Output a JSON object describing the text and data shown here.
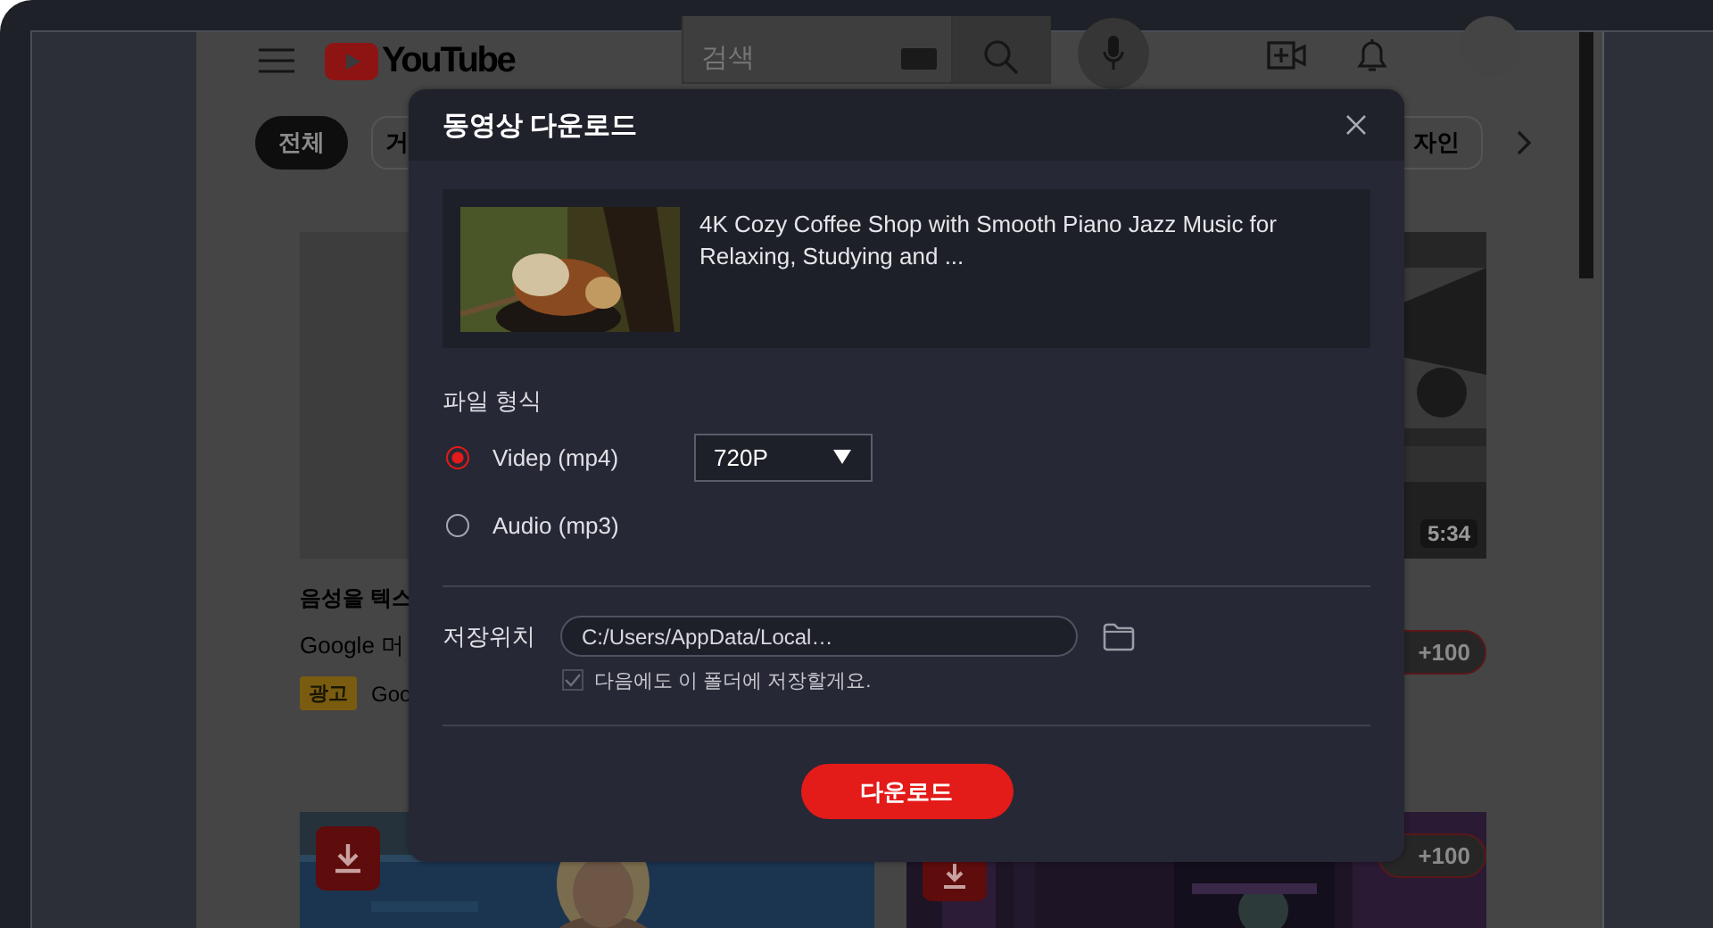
{
  "background": {
    "logo": "YouTube",
    "search": {
      "placeholder": "검색"
    },
    "chips": [
      {
        "label": "전체",
        "selected": true
      },
      {
        "label": "거",
        "selected": false
      },
      {
        "label": "자인",
        "selected": false
      }
    ],
    "cards": [
      {
        "title": "음성을 텍스",
        "channel": "Google 머",
        "ad_badge": "광고",
        "advertiser": "Goo"
      },
      {
        "duration": "5:34",
        "points": "+100"
      }
    ],
    "bottom_cards": [
      {
        "kind": "download"
      },
      {
        "kind": "points",
        "points": "+100"
      }
    ]
  },
  "dialog": {
    "title": "동영상 다운로드",
    "video": {
      "title": "4K Cozy Coffee Shop with Smooth Piano Jazz Music for Relaxing, Studying and ..."
    },
    "format_label": "파일 형식",
    "formats": [
      {
        "label": "Videp (mp4)",
        "selected": true,
        "quality": "720P"
      },
      {
        "label": "Audio (mp3)",
        "selected": false
      }
    ],
    "save_label": "저장위치",
    "save_path": "C:/Users/AppData/Local…",
    "remember": {
      "label": "다음에도 이 폴더에 저장할게요.",
      "checked": true
    },
    "download_button": "다운로드"
  }
}
